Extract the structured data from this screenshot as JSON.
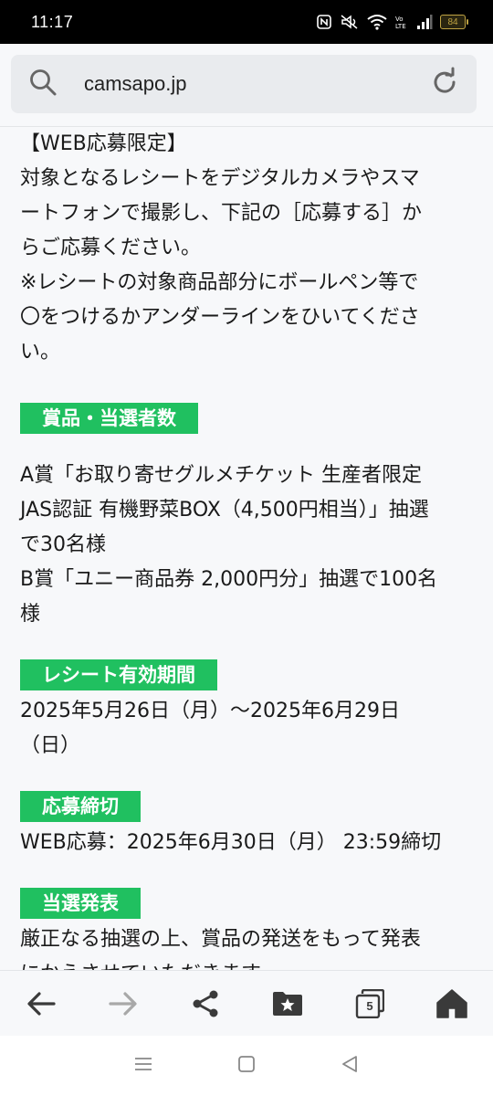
{
  "status_bar": {
    "time": "11:17",
    "battery": "84",
    "icons": [
      "nfc-icon",
      "mute-icon",
      "wifi-icon",
      "volte-icon",
      "signal-icon",
      "battery-icon"
    ]
  },
  "url_bar": {
    "url": "camsapo.jp"
  },
  "content": {
    "intro_lines": [
      "【WEB応募限定】",
      "対象となるレシートをデジタルカメラやスマ",
      "ートフォンで撮影し、下記の［応募する］か",
      "らご応募ください。",
      "※レシートの対象商品部分にボールペン等で",
      "〇をつけるかアンダーラインをひいてくださ",
      "い。"
    ],
    "prizes": {
      "label": "賞品・当選者数",
      "lines": [
        "A賞「お取り寄せグルメチケット 生産者限定",
        "JAS認証 有機野菜BOX（4,500円相当）」抽選",
        "で30名様",
        "B賞「ユニー商品券 2,000円分」抽選で100名",
        "様"
      ]
    },
    "receipt_period": {
      "label": "レシート有効期間",
      "lines": [
        "2025年5月26日（月）～2025年6月29日",
        "（日）"
      ]
    },
    "deadline": {
      "label": "応募締切",
      "lines": [
        "WEB応募：2025年6月30日（月） 23:59締切"
      ]
    },
    "announcement": {
      "label": "当選発表",
      "lines": [
        "厳正なる抽選の上、賞品の発送をもって発表",
        "にかえさせていただきます。"
      ]
    }
  },
  "toolbar": {
    "tab_count": "5",
    "buttons": [
      "back-icon",
      "forward-icon",
      "share-icon",
      "bookmarks-icon",
      "tabs-icon",
      "home-icon"
    ]
  },
  "colors": {
    "section_label_bg": "#20c060",
    "background": "#f7f8fa",
    "toolbar_icon": "#3a3a3a",
    "forward_disabled": "#a8a8a8"
  }
}
